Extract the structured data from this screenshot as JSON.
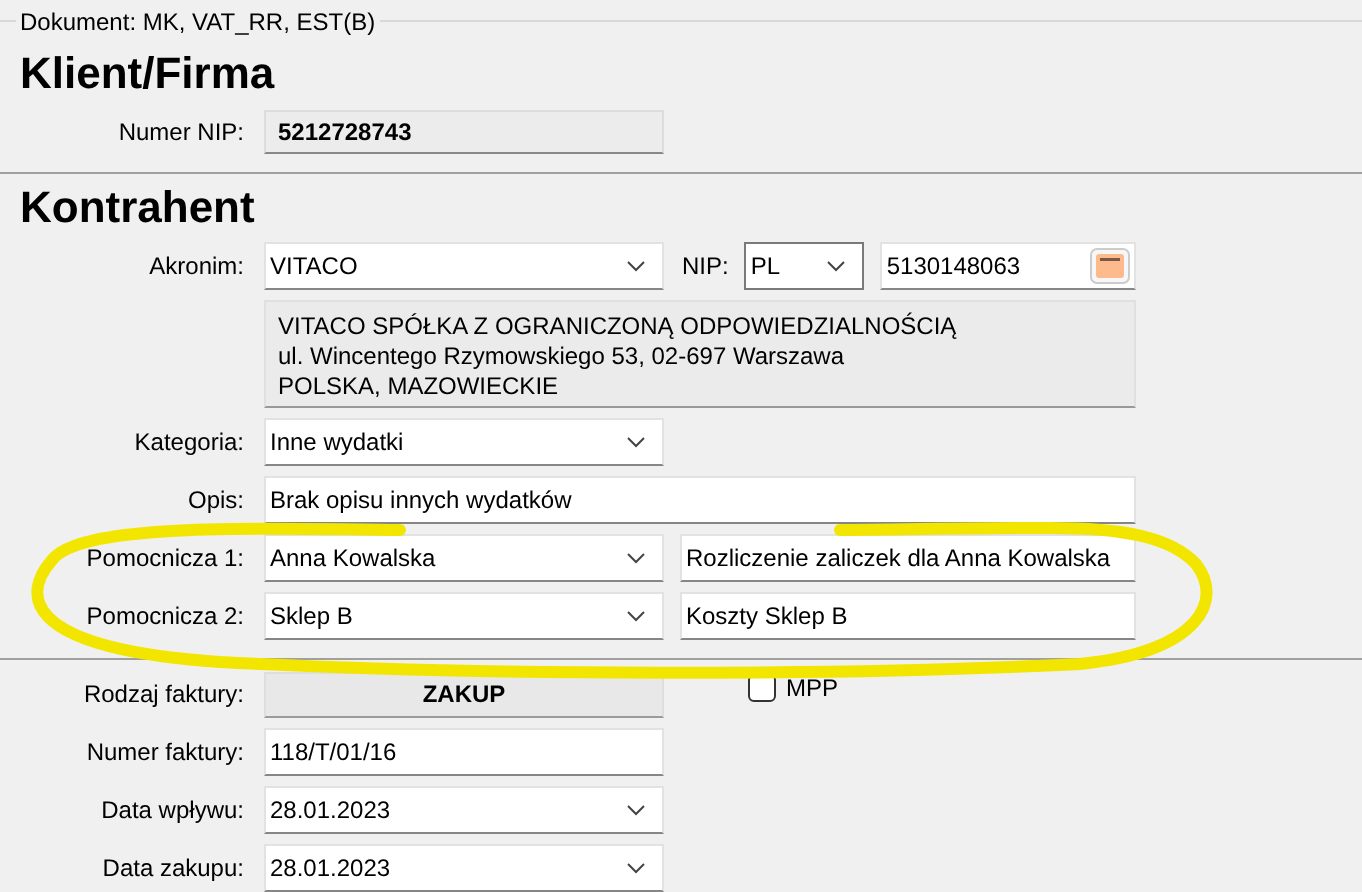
{
  "document_legend": "Dokument: MK, VAT_RR, EST(B)",
  "client": {
    "heading": "Klient/Firma",
    "nip_label": "Numer NIP:",
    "nip_value": "5212728743"
  },
  "contractor": {
    "heading": "Kontrahent",
    "acronym": {
      "label": "Akronim:",
      "value": "VITACO"
    },
    "nip": {
      "label": "NIP:",
      "country": "PL",
      "value": "5130148063"
    },
    "address_lines": [
      "VITACO SPÓŁKA Z OGRANICZONĄ ODPOWIEDZIALNOŚCIĄ",
      "ul. Wincentego Rzymowskiego 53, 02-697 Warszawa",
      "POLSKA, MAZOWIECKIE"
    ],
    "category": {
      "label": "Kategoria:",
      "value": "Inne wydatki"
    },
    "description": {
      "label": "Opis:",
      "value": "Brak opisu innych wydatków"
    },
    "auxiliary": [
      {
        "label": "Pomocnicza 1:",
        "value": "Anna Kowalska",
        "description": "Rozliczenie zaliczek dla Anna Kowalska"
      },
      {
        "label": "Pomocnicza 2:",
        "value": "Sklep B",
        "description": "Koszty Sklep B"
      }
    ]
  },
  "invoice": {
    "type": {
      "label": "Rodzaj faktury:",
      "value": "ZAKUP"
    },
    "mpp": {
      "label": "MPP",
      "checked": false
    },
    "number": {
      "label": "Numer faktury:",
      "value": "118/T/01/16"
    },
    "receipt_date": {
      "label": "Data wpływu:",
      "value": "28.01.2023"
    },
    "purchase_date": {
      "label": "Data zakupu:",
      "value": "28.01.2023"
    }
  },
  "annotation": {
    "kind": "ellipse"
  }
}
